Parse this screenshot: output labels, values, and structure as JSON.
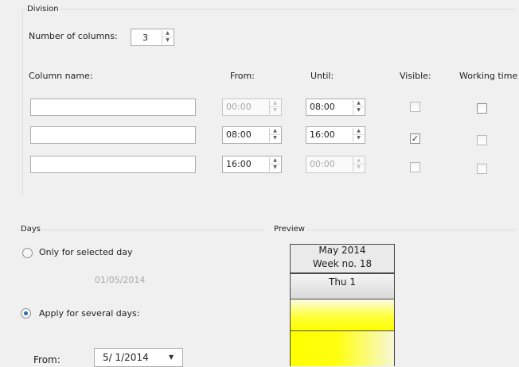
{
  "division": {
    "group_label": "Division",
    "num_columns_label": "Number of columns:",
    "num_columns_value": "3",
    "headers": {
      "column_name": "Column name:",
      "from": "From:",
      "until": "Until:",
      "visible": "Visible:",
      "working_time": "Working time"
    },
    "rows": [
      {
        "name": "",
        "from": "00:00",
        "until": "08:00",
        "from_enabled": false,
        "until_enabled": true,
        "visible": false,
        "working": false
      },
      {
        "name": "",
        "from": "08:00",
        "until": "16:00",
        "from_enabled": true,
        "until_enabled": true,
        "visible": true,
        "working": false
      },
      {
        "name": "",
        "from": "16:00",
        "until": "00:00",
        "from_enabled": true,
        "until_enabled": false,
        "visible": false,
        "working": false
      }
    ]
  },
  "days": {
    "group_label": "Days",
    "only_selected_label": "Only for selected day",
    "selected_date": "01/05/2014",
    "apply_several_label": "Apply for several days:",
    "from_label": "From:",
    "from_value": "5/ 1/2014",
    "selected_option": "apply_several"
  },
  "preview": {
    "group_label": "Preview",
    "month": "May 2014",
    "week": "Week no. 18",
    "day": "Thu 1",
    "colors": {
      "highlight": "#ffff00",
      "header_bg": "#eaeaea"
    }
  },
  "icons": {
    "spin": "spin-up-down-icon",
    "dropdown": "dropdown-arrow-icon",
    "check": "checkmark-icon"
  }
}
